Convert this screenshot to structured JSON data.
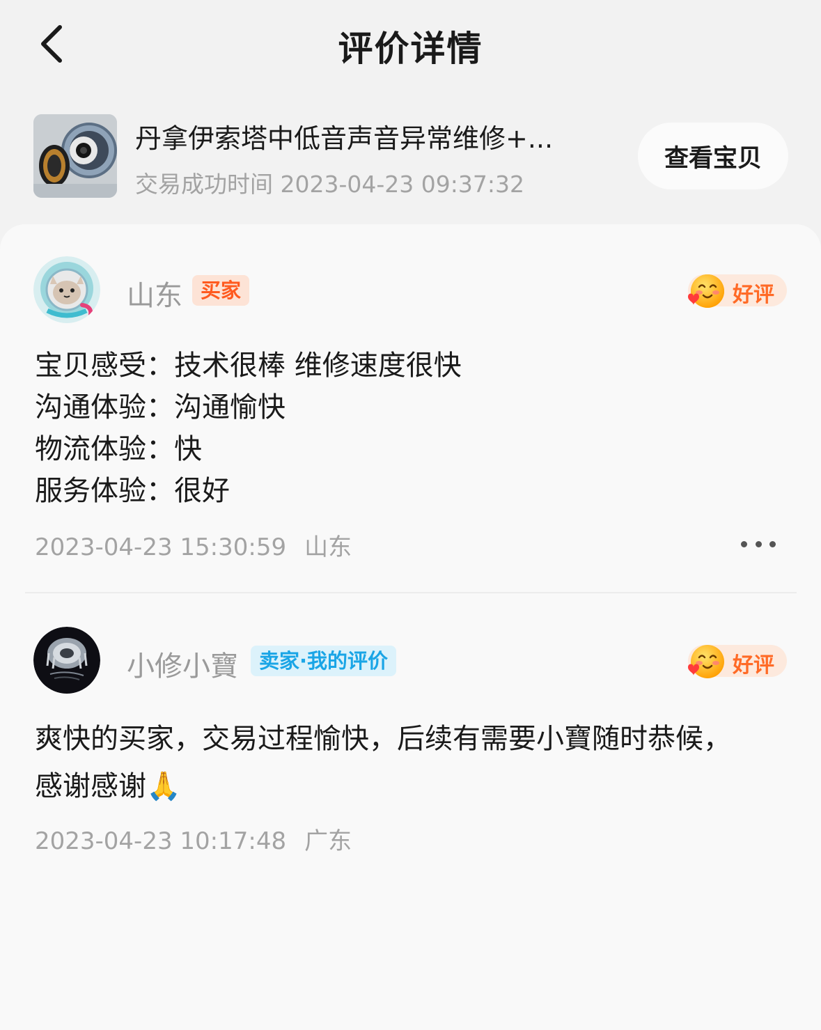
{
  "header": {
    "title": "评价详情"
  },
  "product": {
    "title": "丹拿伊索塔中低音声音异常维修+...",
    "time_label": "交易成功时间 2023-04-23 09:37:32",
    "view_button_label": "查看宝贝"
  },
  "reviews": [
    {
      "user_name": "山东",
      "role_badge": "买家",
      "rating_label": "好评",
      "lines": [
        "宝贝感受：技术很棒 维修速度很快",
        "沟通体验：沟通愉快",
        "物流体验：快",
        "服务体验：很好"
      ],
      "timestamp": "2023-04-23 15:30:59",
      "location": "山东"
    },
    {
      "user_name": "小修小寶",
      "role_badge": "卖家·我的评价",
      "rating_label": "好评",
      "lines": [
        "爽快的买家，交易过程愉快，后续有需要小寶随时恭候，",
        "感谢感谢🙏"
      ],
      "timestamp": "2023-04-23 10:17:48",
      "location": "广东"
    }
  ],
  "colors": {
    "accent_orange": "#ff5a1f",
    "seller_blue": "#1aa5e6",
    "background": "#f2f2f2",
    "card": "#f9f9f9"
  },
  "icons": {
    "back": "chevron-left-icon",
    "more": "more-dots-icon",
    "rating": "smiling-face-emoji-icon"
  }
}
